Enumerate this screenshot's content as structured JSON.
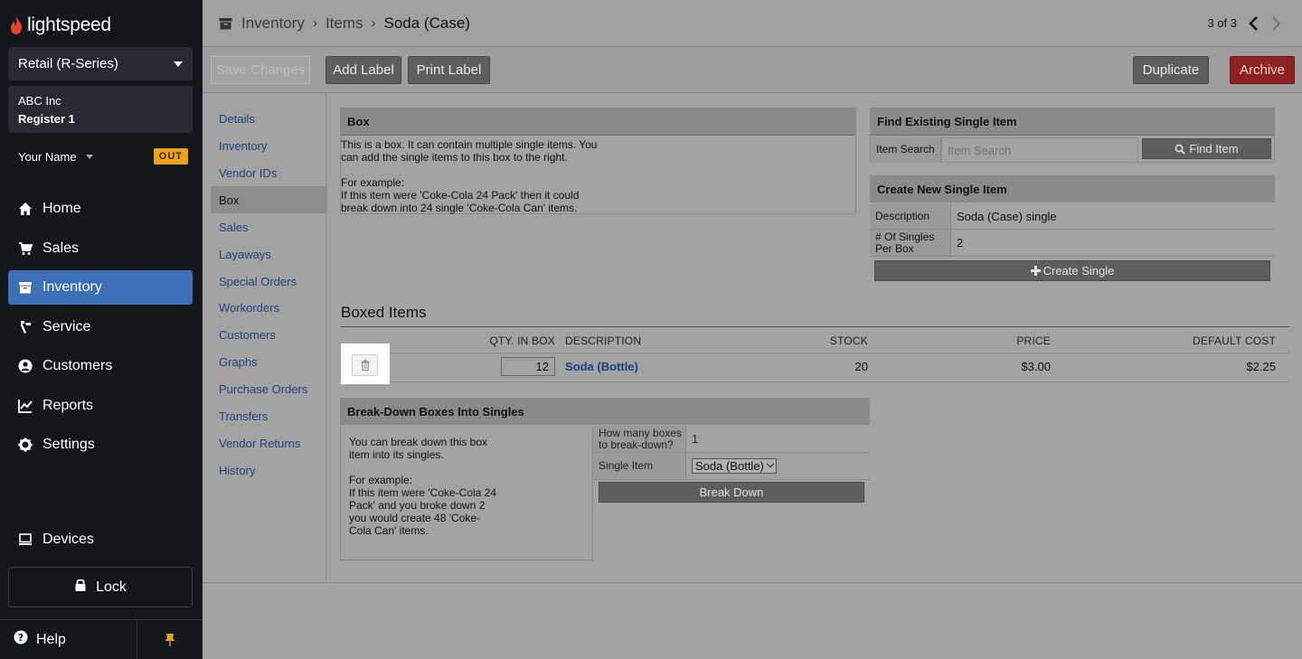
{
  "brand": {
    "name": "lightspeed",
    "accent": "#e8412c"
  },
  "sidebar": {
    "store_selector": "Retail (R-Series)",
    "company": "ABC Inc",
    "register": "Register 1",
    "user_name": "Your Name",
    "out_badge": "OUT",
    "nav": [
      {
        "label": "Home",
        "icon": "home-icon"
      },
      {
        "label": "Sales",
        "icon": "cart-icon"
      },
      {
        "label": "Inventory",
        "icon": "inventory-icon",
        "active": true
      },
      {
        "label": "Service",
        "icon": "wrench-icon"
      },
      {
        "label": "Customers",
        "icon": "user-icon"
      },
      {
        "label": "Reports",
        "icon": "chart-icon"
      },
      {
        "label": "Settings",
        "icon": "gear-icon"
      }
    ],
    "devices": "Devices",
    "lock": "Lock",
    "help": "Help"
  },
  "header": {
    "crumb1": "Inventory",
    "crumb2": "Items",
    "current": "Soda (Case)",
    "pager": "3 of 3"
  },
  "toolbar": {
    "save": "Save Changes",
    "add_label": "Add Label",
    "print_label": "Print Label",
    "duplicate": "Duplicate",
    "archive": "Archive"
  },
  "subnav": [
    "Details",
    "Inventory",
    "Vendor IDs",
    "Box",
    "Sales",
    "Layaways",
    "Special Orders",
    "Workorders",
    "Customers",
    "Graphs",
    "Purchase Orders",
    "Transfers",
    "Vendor Returns",
    "History"
  ],
  "box_panel": {
    "title": "Box",
    "line1": "This is a box. It can contain multiple single items. You can add the single items to this box to the right.",
    "line2": "For example:",
    "line3": "If this item were 'Coke-Cola 24 Pack' then it could break down into 24 single 'Coke-Cola Can' items."
  },
  "find_panel": {
    "title": "Find Existing Single Item",
    "label": "Item Search",
    "placeholder": "Item Search",
    "button": "Find Item"
  },
  "create_panel": {
    "title": "Create New Single Item",
    "desc_label": "Description",
    "desc_value": "Soda (Case) single",
    "singles_label": "# Of Singles Per Box",
    "singles_value": "2",
    "button": "Create Single"
  },
  "boxed_items": {
    "title": "Boxed Items",
    "columns": {
      "qty": "QTY. IN BOX",
      "desc": "DESCRIPTION",
      "stock": "STOCK",
      "price": "PRICE",
      "cost": "DEFAULT COST"
    },
    "rows": [
      {
        "qty": "12",
        "description": "Soda (Bottle)",
        "stock": "20",
        "price": "$3.00",
        "cost": "$2.25"
      }
    ]
  },
  "breakdown": {
    "title": "Break-Down Boxes Into Singles",
    "line1": "You can break down this box item into its singles.",
    "line2": "For example:",
    "line3": "If this item were 'Coke-Cola 24 Pack' and you broke down 2 you would create 48 'Coke-Cola Can' items.",
    "boxes_label": "How many boxes to break-down?",
    "boxes_value": "1",
    "single_label": "Single Item",
    "single_value": "Soda (Bottle)",
    "button": "Break Down"
  }
}
